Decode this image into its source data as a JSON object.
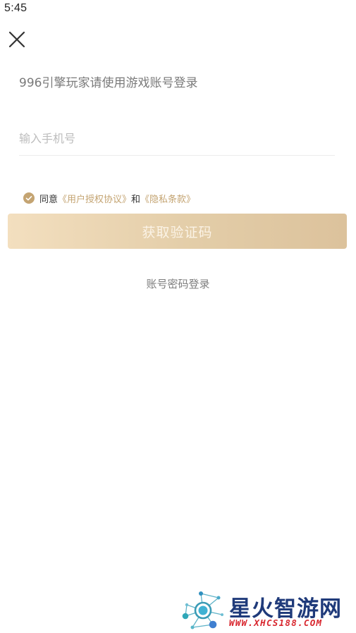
{
  "status_bar": {
    "time": "5:45"
  },
  "login": {
    "subtitle": "996引擎玩家请使用游戏账号登录",
    "phone_placeholder": "输入手机号",
    "phone_value": "",
    "agree": {
      "checked": true,
      "prefix": "同意",
      "user_agreement": "《用户授权协议》",
      "conjunction": "和",
      "privacy": "《隐私条款》"
    },
    "get_code_button": "获取验证码",
    "password_login_link": "账号密码登录"
  },
  "watermark": {
    "title": "星火智游网",
    "url": "WWW.XHCS188.COM"
  },
  "colors": {
    "accent_gold": "#c4a472",
    "button_gradient_start": "#f3dfbf",
    "button_gradient_end": "#dcc29c",
    "watermark_title": "#1f3a7a",
    "watermark_url": "#d8262e"
  },
  "icons": {
    "close": "close-icon",
    "check": "check-circle-icon",
    "watermark_logo": "molecule-logo-icon"
  }
}
